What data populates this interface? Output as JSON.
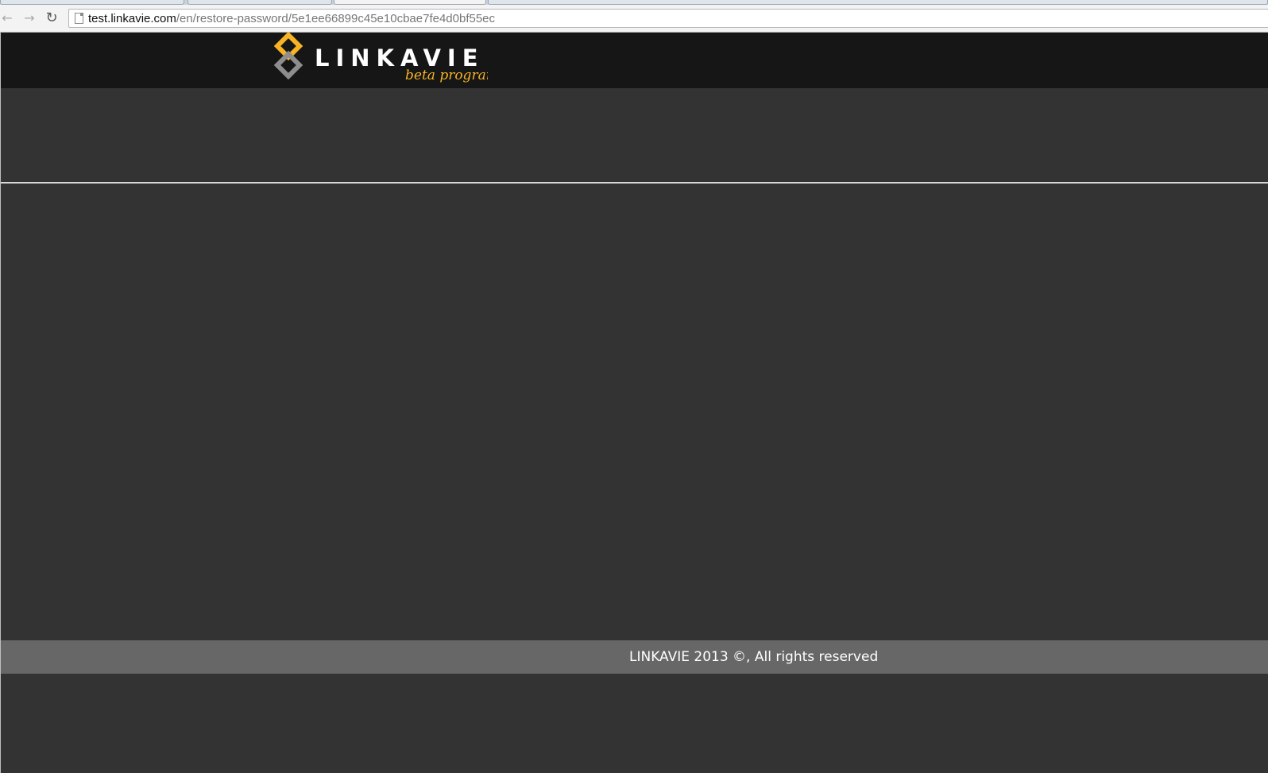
{
  "browser": {
    "url_host": "test.linkavie.com",
    "url_path": "/en/restore-password/5e1ee66899c45e10cbae7fe4d0bf55ec",
    "back_icon": "arrow-left-icon",
    "forward_icon": "arrow-right-icon",
    "reload_icon": "reload-icon",
    "page_icon": "page-icon"
  },
  "header": {
    "logo_text": "LINKAVIE",
    "logo_tagline": "beta program"
  },
  "footer": {
    "text": "LINKAVIE 2013 ©, All rights reserved"
  },
  "colors": {
    "header_bg": "#161616",
    "page_bg": "#333333",
    "footer_bg": "#676767",
    "accent_orange": "#f7b323",
    "logo_gray": "#8d8d8d"
  }
}
